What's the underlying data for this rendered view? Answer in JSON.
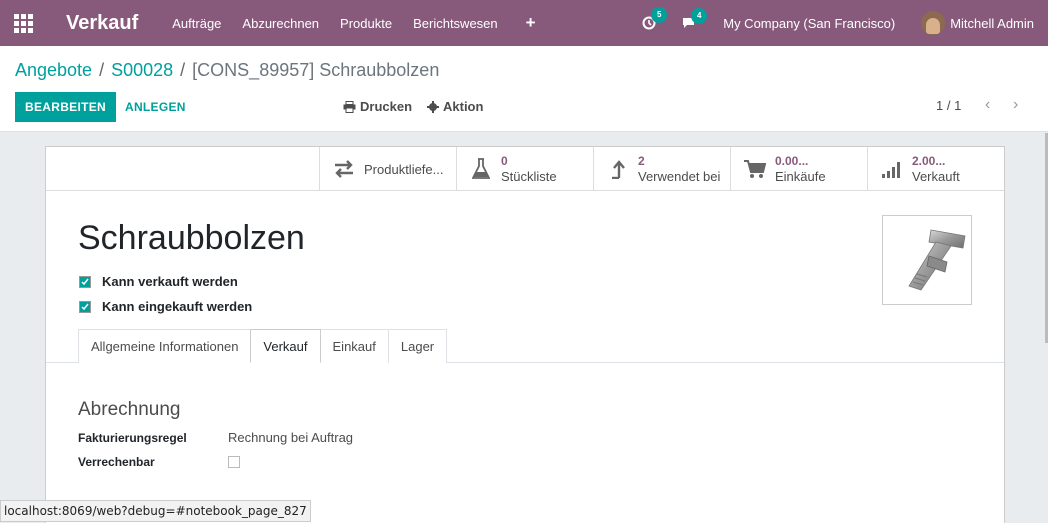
{
  "navbar": {
    "brand": "Verkauf",
    "menu": [
      "Aufträge",
      "Abzurechnen",
      "Produkte",
      "Berichtswesen"
    ],
    "plus": "+",
    "activity_count": "5",
    "message_count": "4",
    "company": "My Company (San Francisco)",
    "user": "Mitchell Admin"
  },
  "breadcrumb": {
    "item1": "Angebote",
    "sep": "/",
    "item2": "S00028",
    "current": "[CONS_89957] Schraubbolzen"
  },
  "actions": {
    "edit": "BEARBEITEN",
    "create": "ANLEGEN",
    "print": "Drucken",
    "action": "Aktion"
  },
  "pager": {
    "value": "1 / 1"
  },
  "smart_buttons": {
    "routes": "Produktliefe...",
    "bom_value": "0",
    "bom_label": "Stückliste",
    "used_value": "2",
    "used_label": "Verwendet bei",
    "purchase_value": "0.00...",
    "purchase_label": "Einkäufe",
    "sales_value": "2.00...",
    "sales_label": "Verkauft"
  },
  "product": {
    "name": "Schraubbolzen",
    "can_be_sold": "Kann verkauft werden",
    "can_be_purchased": "Kann eingekauft werden"
  },
  "tabs": [
    "Allgemeine Informationen",
    "Verkauf",
    "Einkauf",
    "Lager"
  ],
  "invoicing": {
    "title": "Abrechnung",
    "policy_label": "Fakturierungsregel",
    "policy_value": "Rechnung bei Auftrag",
    "expense_label": "Verrechenbar"
  },
  "status_bar": "localhost:8069/web?debug=#notebook_page_827",
  "colors": {
    "brand": "#875a7b",
    "accent": "#00a09d"
  }
}
